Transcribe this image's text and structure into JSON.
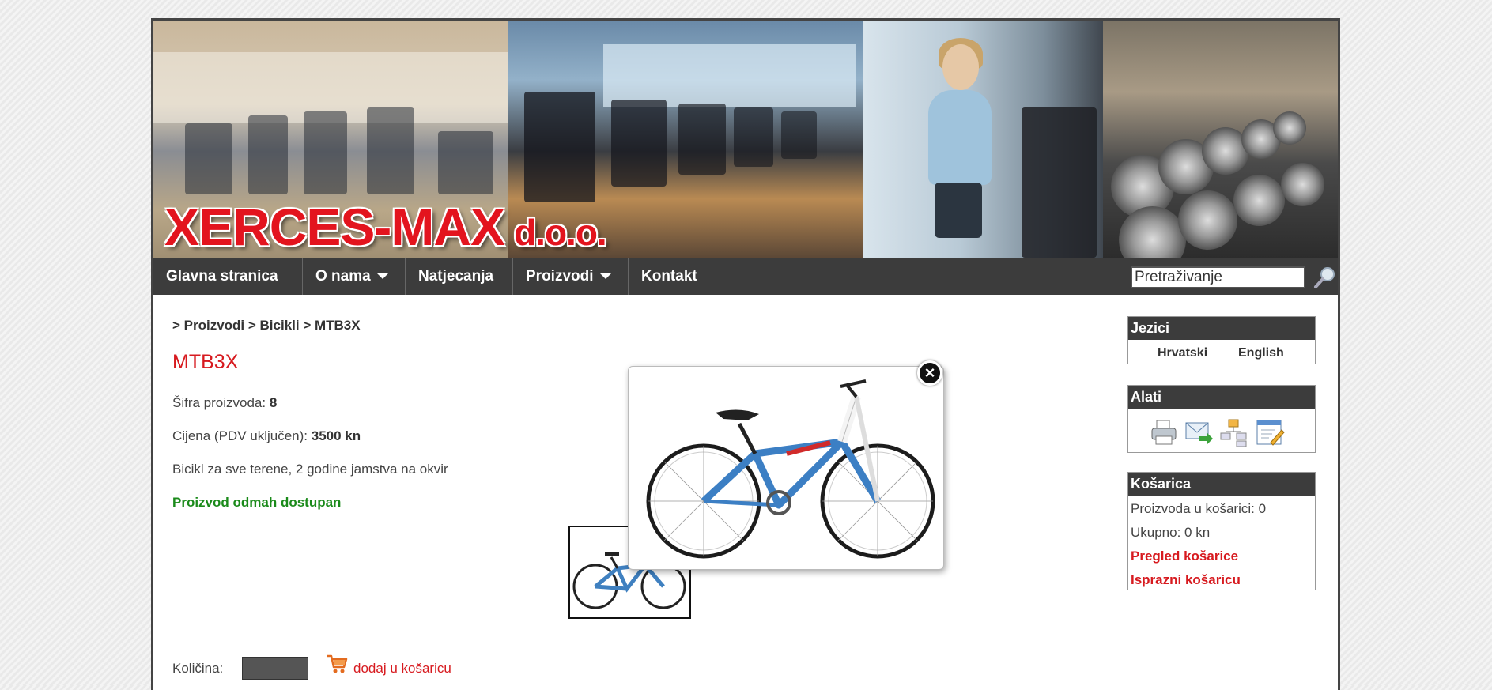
{
  "header": {
    "logo_main": "XERCES-MAX",
    "logo_suffix": "d.o.o."
  },
  "nav": {
    "items": [
      {
        "label": "Glavna stranica",
        "has_dropdown": false
      },
      {
        "label": "O nama",
        "has_dropdown": true
      },
      {
        "label": "Natjecanja",
        "has_dropdown": false
      },
      {
        "label": "Proizvodi",
        "has_dropdown": true
      },
      {
        "label": "Kontakt",
        "has_dropdown": false
      }
    ],
    "search_value": "Pretraživanje",
    "search_icon": "magnifier-icon"
  },
  "breadcrumb": "> Proizvodi > Bicikli > MTB3X",
  "product": {
    "title": "MTB3X",
    "code_label": "Šifra proizvoda:",
    "code_value": "8",
    "price_label": "Cijena (PDV uključen):",
    "price_value": "3500 kn",
    "description": "Bicikl za sve terene, 2 godine jamstva na okvir",
    "availability": "Proizvod odmah dostupan",
    "quantity_label": "Količina:",
    "quantity_value": "",
    "add_to_cart_label": "dodaj u košaricu"
  },
  "sidebar": {
    "languages": {
      "title": "Jezici",
      "items": [
        "Hrvatski",
        "English"
      ]
    },
    "tools": {
      "title": "Alati",
      "icons": [
        "print-icon",
        "email-icon",
        "sitemap-icon",
        "edit-icon"
      ]
    },
    "cart": {
      "title": "Košarica",
      "count_text": "Proizvoda u košarici: 0",
      "total_text": "Ukupno: 0 kn",
      "view_link": "Pregled košarice",
      "empty_link": "Isprazni košaricu"
    }
  },
  "colors": {
    "accent_red": "#d71a1f",
    "nav_bg": "#3c3c3c",
    "available_green": "#1a8a1a"
  }
}
